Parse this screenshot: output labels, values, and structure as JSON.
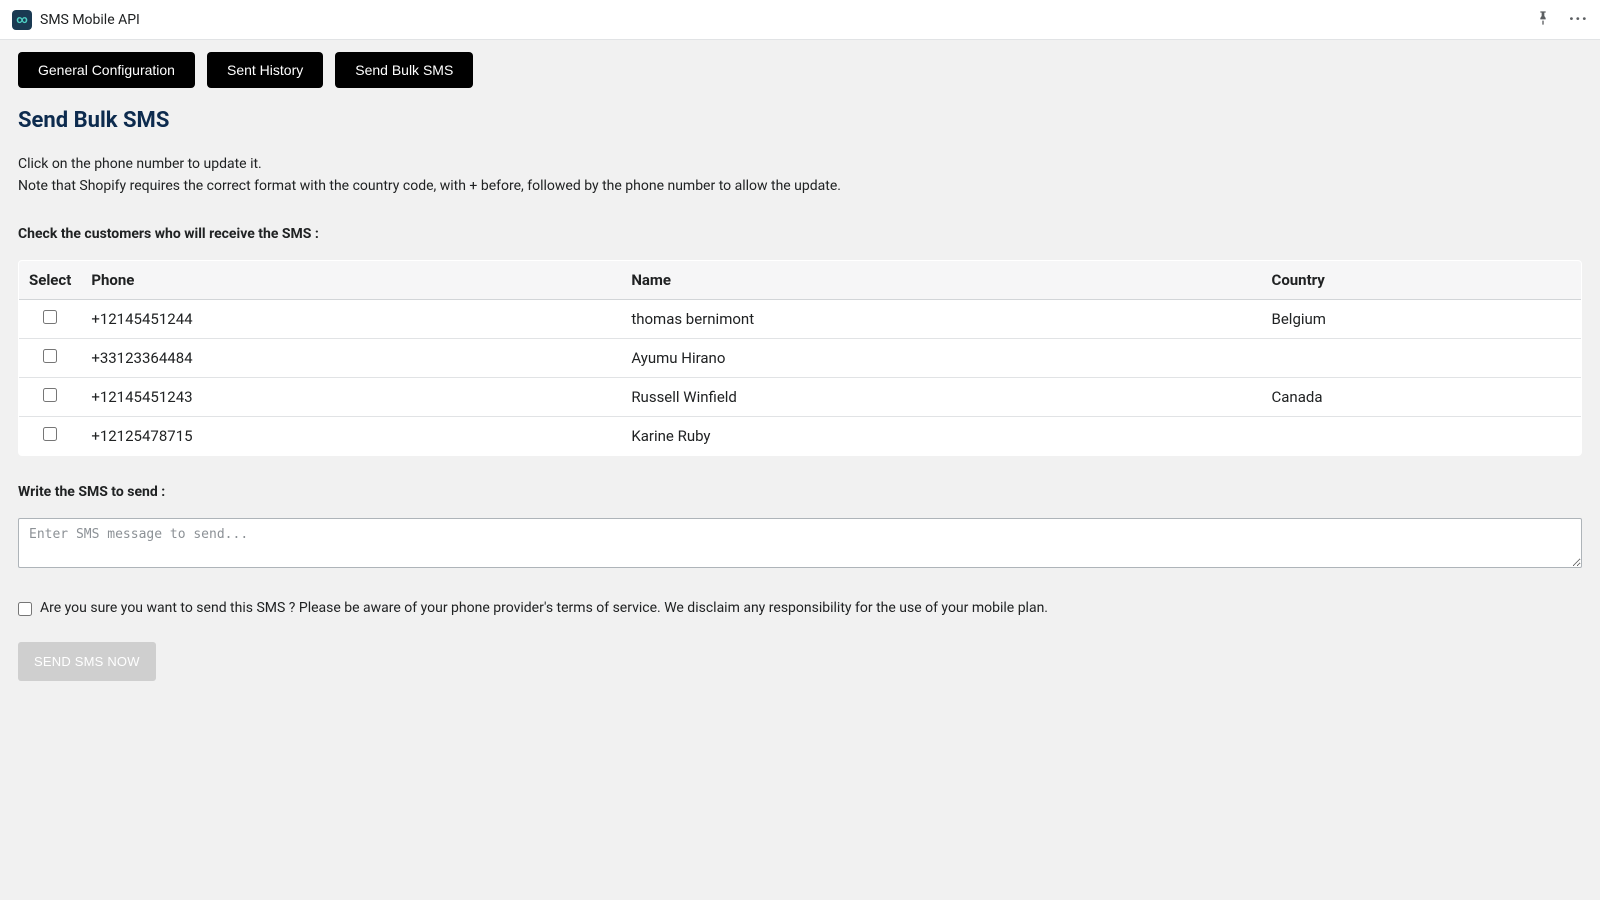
{
  "header": {
    "app_title": "SMS Mobile API",
    "app_icon_text": "∞"
  },
  "tabs": [
    {
      "label": "General Configuration"
    },
    {
      "label": "Sent History"
    },
    {
      "label": "Send Bulk SMS"
    }
  ],
  "page": {
    "heading": "Send Bulk SMS",
    "description_line1": "Click on the phone number to update it.",
    "description_line2": "Note that Shopify requires the correct format with the country code, with + before, followed by the phone number to allow the update.",
    "check_customers_label": "Check the customers who will receive the SMS :",
    "write_sms_label": "Write the SMS to send :",
    "sms_placeholder": "Enter SMS message to send...",
    "confirm_text": "Are you sure you want to send this SMS ? Please be aware of your phone provider's terms of service. We disclaim any responsibility for the use of your mobile plan.",
    "send_button_label": "SEND SMS NOW"
  },
  "table": {
    "headers": {
      "select": "Select",
      "phone": "Phone",
      "name": "Name",
      "country": "Country"
    },
    "rows": [
      {
        "phone": "+12145451244",
        "name": "thomas bernimont",
        "country": "Belgium"
      },
      {
        "phone": "+33123364484",
        "name": "Ayumu Hirano",
        "country": ""
      },
      {
        "phone": "+12145451243",
        "name": "Russell Winfield",
        "country": "Canada"
      },
      {
        "phone": "+12125478715",
        "name": "Karine Ruby",
        "country": ""
      }
    ]
  }
}
